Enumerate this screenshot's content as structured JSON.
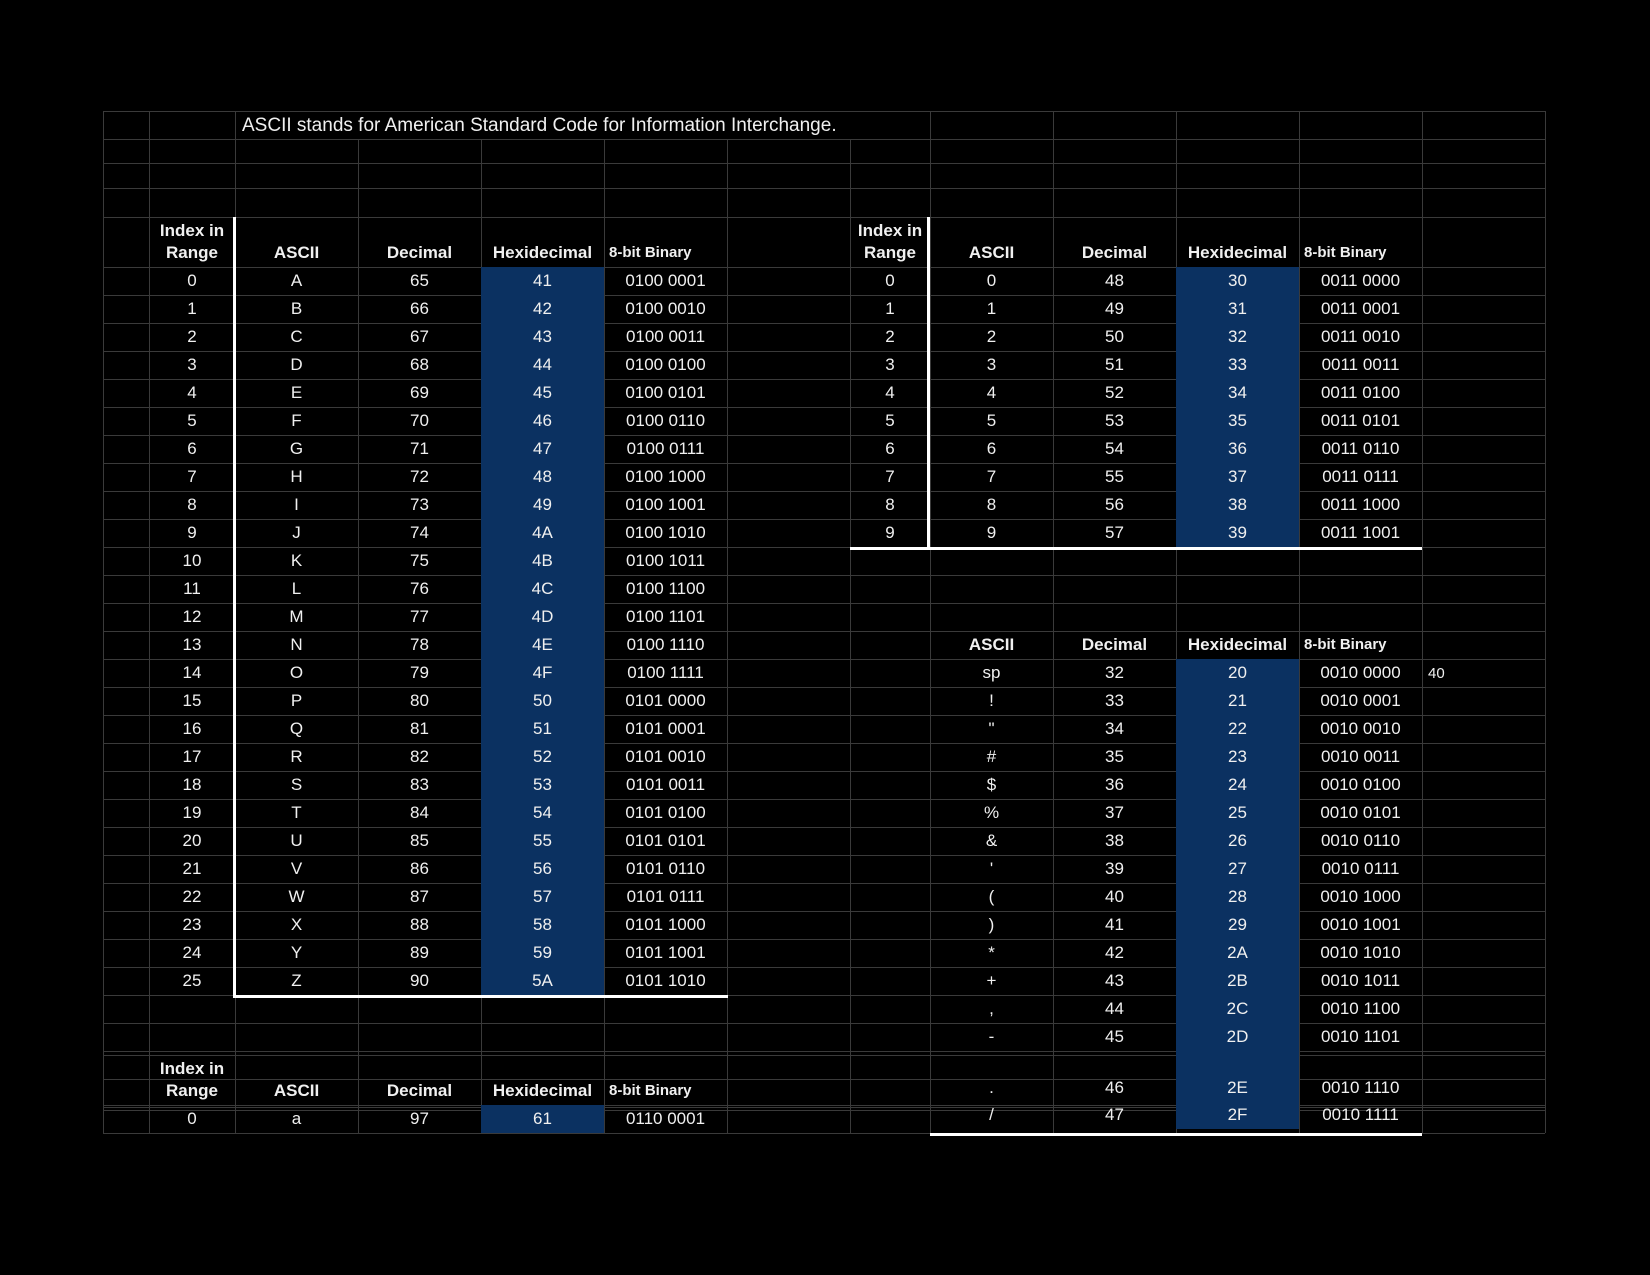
{
  "title": "ASCII stands for American Standard Code for Information Interchange.",
  "colors": {
    "background": "#000000",
    "hex_fill": "#0b3161",
    "grid": "#3a3a3a",
    "rule": "#ffffff",
    "text": "#f0f0f0"
  },
  "headers": {
    "index": [
      "Index in",
      "Range"
    ],
    "ascii": "ASCII",
    "decimal": "Decimal",
    "hex": "Hexidecimal",
    "binary": "8-bit Binary"
  },
  "uppercase_rows": [
    [
      "0",
      "A",
      "65",
      "41",
      "0100 0001"
    ],
    [
      "1",
      "B",
      "66",
      "42",
      "0100 0010"
    ],
    [
      "2",
      "C",
      "67",
      "43",
      "0100 0011"
    ],
    [
      "3",
      "D",
      "68",
      "44",
      "0100 0100"
    ],
    [
      "4",
      "E",
      "69",
      "45",
      "0100 0101"
    ],
    [
      "5",
      "F",
      "70",
      "46",
      "0100 0110"
    ],
    [
      "6",
      "G",
      "71",
      "47",
      "0100 0111"
    ],
    [
      "7",
      "H",
      "72",
      "48",
      "0100 1000"
    ],
    [
      "8",
      "I",
      "73",
      "49",
      "0100 1001"
    ],
    [
      "9",
      "J",
      "74",
      "4A",
      "0100 1010"
    ],
    [
      "10",
      "K",
      "75",
      "4B",
      "0100 1011"
    ],
    [
      "11",
      "L",
      "76",
      "4C",
      "0100 1100"
    ],
    [
      "12",
      "M",
      "77",
      "4D",
      "0100 1101"
    ],
    [
      "13",
      "N",
      "78",
      "4E",
      "0100 1110"
    ],
    [
      "14",
      "O",
      "79",
      "4F",
      "0100 1111"
    ],
    [
      "15",
      "P",
      "80",
      "50",
      "0101 0000"
    ],
    [
      "16",
      "Q",
      "81",
      "51",
      "0101 0001"
    ],
    [
      "17",
      "R",
      "82",
      "52",
      "0101 0010"
    ],
    [
      "18",
      "S",
      "83",
      "53",
      "0101 0011"
    ],
    [
      "19",
      "T",
      "84",
      "54",
      "0101 0100"
    ],
    [
      "20",
      "U",
      "85",
      "55",
      "0101 0101"
    ],
    [
      "21",
      "V",
      "86",
      "56",
      "0101 0110"
    ],
    [
      "22",
      "W",
      "87",
      "57",
      "0101 0111"
    ],
    [
      "23",
      "X",
      "88",
      "58",
      "0101 1000"
    ],
    [
      "24",
      "Y",
      "89",
      "59",
      "0101 1001"
    ],
    [
      "25",
      "Z",
      "90",
      "5A",
      "0101 1010"
    ]
  ],
  "lowercase_rows": [
    [
      "0",
      "a",
      "97",
      "61",
      "0110 0001"
    ]
  ],
  "digit_rows": [
    [
      "0",
      "0",
      "48",
      "30",
      "0011 0000"
    ],
    [
      "1",
      "1",
      "49",
      "31",
      "0011 0001"
    ],
    [
      "2",
      "2",
      "50",
      "32",
      "0011 0010"
    ],
    [
      "3",
      "3",
      "51",
      "33",
      "0011 0011"
    ],
    [
      "4",
      "4",
      "52",
      "34",
      "0011 0100"
    ],
    [
      "5",
      "5",
      "53",
      "35",
      "0011 0101"
    ],
    [
      "6",
      "6",
      "54",
      "36",
      "0011 0110"
    ],
    [
      "7",
      "7",
      "55",
      "37",
      "0011 0111"
    ],
    [
      "8",
      "8",
      "56",
      "38",
      "0011 1000"
    ],
    [
      "9",
      "9",
      "57",
      "39",
      "0011 1001"
    ]
  ],
  "symbol_rows": [
    [
      "sp",
      "32",
      "20",
      "0010 0000"
    ],
    [
      "!",
      "33",
      "21",
      "0010 0001"
    ],
    [
      "\"",
      "34",
      "22",
      "0010 0010"
    ],
    [
      "#",
      "35",
      "23",
      "0010 0011"
    ],
    [
      "$",
      "36",
      "24",
      "0010 0100"
    ],
    [
      "%",
      "37",
      "25",
      "0010 0101"
    ],
    [
      "&",
      "38",
      "26",
      "0010 0110"
    ],
    [
      "'",
      "39",
      "27",
      "0010 0111"
    ],
    [
      "(",
      "40",
      "28",
      "0010 1000"
    ],
    [
      ")",
      "41",
      "29",
      "0010 1001"
    ],
    [
      "*",
      "42",
      "2A",
      "0010 1010"
    ],
    [
      "+",
      "43",
      "2B",
      "0010 1011"
    ],
    [
      ",",
      "44",
      "2C",
      "0010 1100"
    ],
    [
      "-",
      "45",
      "2D",
      "0010 1101"
    ],
    [
      ".",
      "46",
      "2E",
      "0010 1110"
    ],
    [
      "/",
      "47",
      "2F",
      "0010 1111"
    ]
  ],
  "side_note": "40"
}
